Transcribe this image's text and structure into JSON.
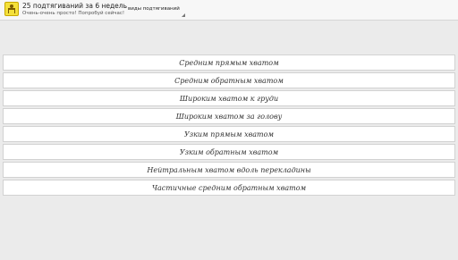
{
  "action_bar": {
    "title": "25 подтягиваний за 6 недель",
    "subtitle": "Очень-очень просто! Попробуй сейчас!",
    "spinner": {
      "selected": "виды подтягиваний"
    }
  },
  "list": {
    "items": [
      {
        "label": "Средним прямым хватом"
      },
      {
        "label": "Средним обратным хватом"
      },
      {
        "label": "Широким хватом к груди"
      },
      {
        "label": "Широким хватом за голову"
      },
      {
        "label": "Узким прямым хватом"
      },
      {
        "label": "Узким обратным хватом"
      },
      {
        "label": "Нейтральным хватом вдоль перекладины"
      },
      {
        "label": "Частичные средним обратным хватом"
      }
    ]
  },
  "colors": {
    "action_bar_bg": "#f7f7f7",
    "content_bg": "#ebebeb",
    "icon_bg": "#f4e03a"
  },
  "icons": {
    "app_icon": "pullup-figure-icon",
    "spinner_arrow": "dropdown-corner-icon"
  }
}
